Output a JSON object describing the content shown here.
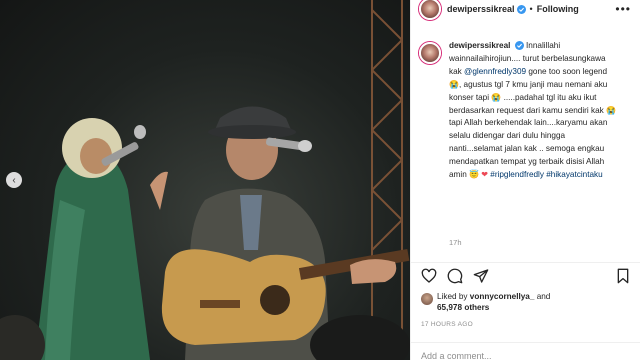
{
  "post": {
    "username": "dewiperssikreal",
    "follow_label": "Following",
    "more_label": "•••"
  },
  "caption": {
    "username": "dewiperssikreal",
    "part1": "Innalillahi wainnailaihirojiun.... turut berbelasungkawa kak",
    "mention": "@glennfredly309",
    "part2": "gone too soon legend",
    "part3": "agustus tgl 7 kmu janji mau nemani aku konser tapi",
    "part4": ".....padahal tgl itu aku ikut berdasarkan request dari kamu sendiri kak",
    "part5": "tapi Allah berkehendak lain....karyamu akan selalu didengar dari dulu hingga nanti...selamat jalan kak .. semoga engkau mendapatkan tempat yg terbaik disisi Allah amin",
    "hashtags": "#ripglendfredly #hikayatcintaku",
    "time": "17h"
  },
  "likes": {
    "prefix": "Liked by",
    "user": "vonnycornellya_",
    "conj": "and",
    "count": "65,978 others"
  },
  "timestamp": "17 HOURS AGO",
  "comment": {
    "placeholder": "Add a comment..."
  },
  "colors": {
    "verified": "#3897f0",
    "link": "#00376b",
    "heart": "#ed4956"
  }
}
